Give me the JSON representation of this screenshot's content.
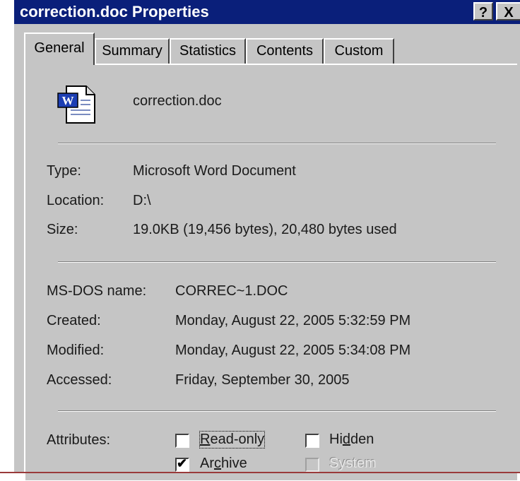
{
  "window": {
    "title": "correction.doc Properties",
    "help_label": "?",
    "close_label": "X"
  },
  "tabs": [
    {
      "label": "General",
      "active": true
    },
    {
      "label": "Summary",
      "active": false
    },
    {
      "label": "Statistics",
      "active": false
    },
    {
      "label": "Contents",
      "active": false
    },
    {
      "label": "Custom",
      "active": false
    }
  ],
  "file": {
    "icon": "word-document-icon",
    "name": "correction.doc"
  },
  "details": {
    "type_label": "Type:",
    "type_value": "Microsoft Word Document",
    "location_label": "Location:",
    "location_value": "D:\\",
    "size_label": "Size:",
    "size_value": "19.0KB (19,456 bytes), 20,480 bytes used"
  },
  "dates": {
    "msdos_label": "MS-DOS name:",
    "msdos_value": "CORREC~1.DOC",
    "created_label": "Created:",
    "created_value": "Monday, August 22, 2005 5:32:59 PM",
    "modified_label": "Modified:",
    "modified_value": "Monday, August 22, 2005 5:34:08 PM",
    "accessed_label": "Accessed:",
    "accessed_value": "Friday, September 30, 2005"
  },
  "attributes": {
    "label": "Attributes:",
    "readonly": {
      "pre": "",
      "key": "R",
      "post": "ead-only",
      "checked": false
    },
    "hidden": {
      "pre": "Hi",
      "key": "d",
      "post": "den",
      "checked": false
    },
    "archive": {
      "pre": "Ar",
      "key": "c",
      "post": "hive",
      "checked": true
    },
    "system": {
      "label": "System",
      "checked": false,
      "disabled": true
    }
  },
  "colors": {
    "titlebar": "#0a1f7a",
    "face": "#c5c5c5"
  }
}
